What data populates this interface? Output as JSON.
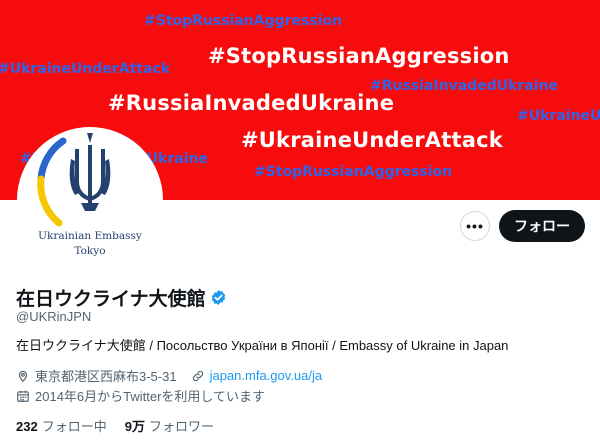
{
  "banner": {
    "tags": [
      {
        "text": "#StopRussianAggression",
        "style": "blue"
      },
      {
        "text": "#UkraineUnderAttack",
        "style": "blue"
      },
      {
        "text": "#StopRussianAggression",
        "style": "white"
      },
      {
        "text": "#RussiaInvadedUkraine",
        "style": "blue"
      },
      {
        "text": "#RussiaInvadedUkraine",
        "style": "white"
      },
      {
        "text": "#UkraineUnderAttack",
        "style": "blue"
      },
      {
        "text": "#UkraineUnderAttack",
        "style": "white"
      },
      {
        "text": "#RussiaInvadedUkraine",
        "style": "blue"
      },
      {
        "text": "#StopRussianAggression",
        "style": "blue"
      }
    ],
    "colors": {
      "background": "#f60c0c",
      "white_text": "#ffffff",
      "blue_text": "#2f64e8"
    }
  },
  "avatar": {
    "line1": "Ukrainian Embassy",
    "line2": "Tokyo",
    "icon": "ukraine-trident-icon"
  },
  "actions": {
    "more_label": "•••",
    "follow_label": "フォロー"
  },
  "profile": {
    "name": "在日ウクライナ大使館",
    "handle": "@UKRinJPN",
    "bio": "在日ウクライナ大使館 / Посольство України в Японії / Embassy of Ukraine in Japan",
    "location": "東京都港区西麻布3-5-31",
    "website": "japan.mfa.gov.ua/ja",
    "joined": "2014年6月からTwitterを利用しています"
  },
  "stats": {
    "following_count": "232",
    "following_label": "フォロー中",
    "followers_count": "9万",
    "followers_label": "フォロワー"
  }
}
